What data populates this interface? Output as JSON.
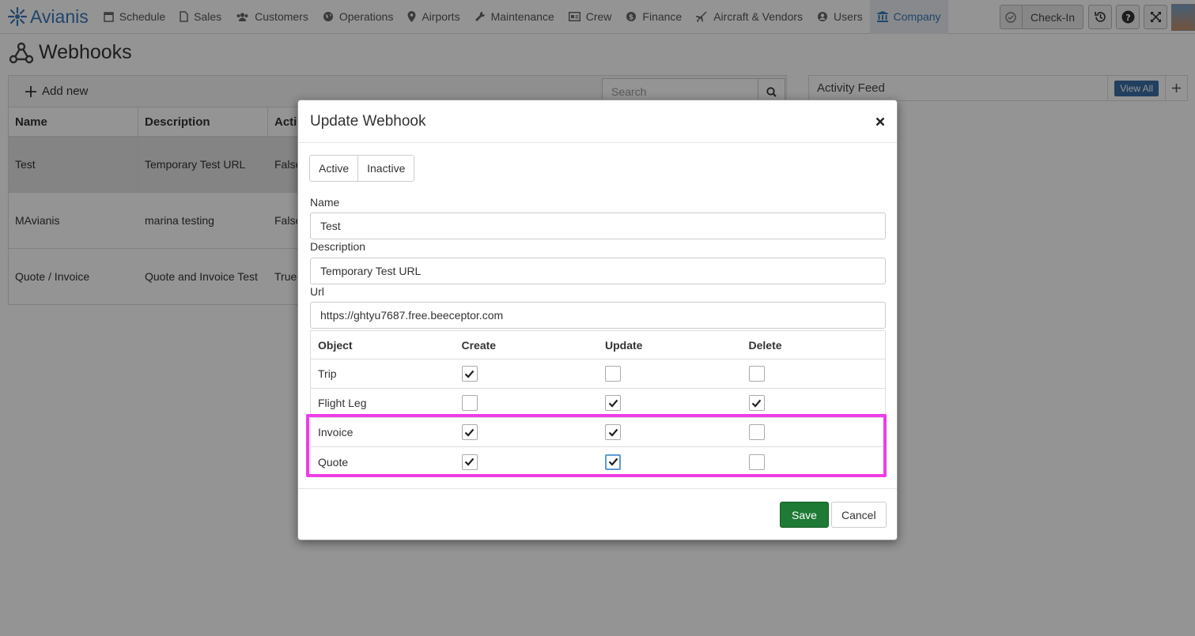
{
  "app": {
    "logo_text": "Avianis",
    "logo_icon": "sunburst-logo-icon"
  },
  "nav": {
    "items": [
      {
        "label": "Schedule",
        "icon": "calendar-icon"
      },
      {
        "label": "Sales",
        "icon": "document-icon"
      },
      {
        "label": "Customers",
        "icon": "users-icon"
      },
      {
        "label": "Operations",
        "icon": "globe-icon"
      },
      {
        "label": "Airports",
        "icon": "map-pin-icon"
      },
      {
        "label": "Maintenance",
        "icon": "wrench-icon"
      },
      {
        "label": "Crew",
        "icon": "id-card-icon"
      },
      {
        "label": "Finance",
        "icon": "dollar-icon"
      },
      {
        "label": "Aircraft & Vendors",
        "icon": "plane-icon"
      },
      {
        "label": "Users",
        "icon": "user-circle-icon"
      },
      {
        "label": "Company",
        "icon": "building-icon"
      }
    ],
    "active": "Company",
    "checkin_label": "Check-In"
  },
  "page": {
    "title": "Webhooks",
    "add_new_label": "Add new",
    "search_placeholder": "Search",
    "columns": [
      "Name",
      "Description",
      "Acti"
    ],
    "rows": [
      {
        "name": "Test",
        "description": "Temporary Test URL",
        "active": "False"
      },
      {
        "name": "MAvianis",
        "description": "marina testing",
        "active": "False"
      },
      {
        "name": "Quote / Invoice",
        "description": "Quote and Invoice Test",
        "active": "True"
      }
    ],
    "selected_row": 0
  },
  "activity": {
    "title": "Activity Feed",
    "view_all_label": "View All"
  },
  "modal": {
    "title": "Update Webhook",
    "status_options": [
      "Active",
      "Inactive"
    ],
    "name_label": "Name",
    "name_value": "Test",
    "description_label": "Description",
    "description_value": "Temporary Test URL",
    "url_label": "Url",
    "url_value": "https://ghtyu7687.free.beeceptor.com",
    "permissions": {
      "headers": [
        "Object",
        "Create",
        "Update",
        "Delete"
      ],
      "rows": [
        {
          "object": "Trip",
          "create": true,
          "update": false,
          "delete": false
        },
        {
          "object": "Flight Leg",
          "create": false,
          "update": true,
          "delete": true
        },
        {
          "object": "Invoice",
          "create": true,
          "update": true,
          "delete": false
        },
        {
          "object": "Quote",
          "create": true,
          "update": true,
          "delete": false
        }
      ]
    },
    "save_label": "Save",
    "cancel_label": "Cancel",
    "highlight_color": "#ee3de6"
  }
}
